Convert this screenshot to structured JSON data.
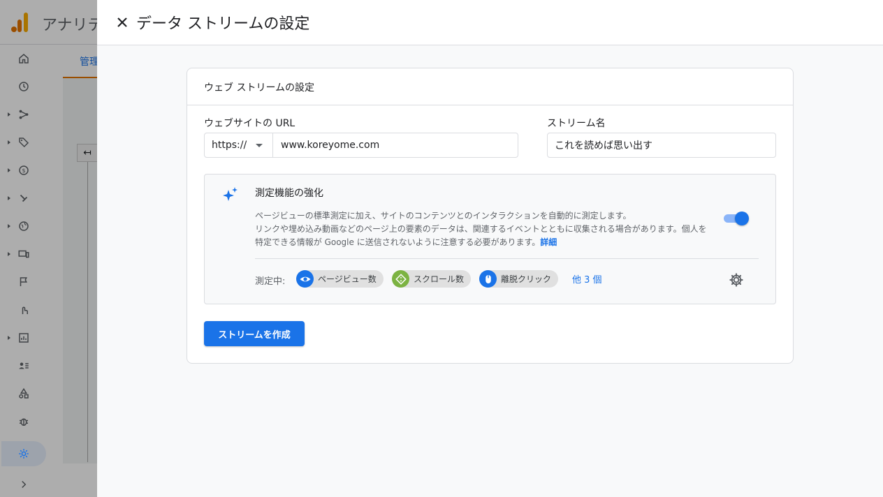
{
  "background_app": {
    "title": "アナリテ",
    "tab_label": "管理",
    "back_glyph": "↤"
  },
  "panel": {
    "title": "データ ストリームの設定"
  },
  "card": {
    "title": "ウェブ ストリームの設定",
    "url_label": "ウェブサイトの URL",
    "protocol_value": "https://",
    "url_value": "www.koreyome.com",
    "stream_name_label": "ストリーム名",
    "stream_name_value": "これを読めば思い出す"
  },
  "enhanced": {
    "title": "測定機能の強化",
    "desc_line1": "ページビューの標準測定に加え、サイトのコンテンツとのインタラクションを自動的に測定します。",
    "desc_line2": "リンクや埋め込み動画などのページ上の要素のデータは、関連するイベントとともに収集される場合があります。個人を",
    "desc_line3": "特定できる情報が Google に送信されないように注意する必要があります。",
    "details_link": "詳細",
    "toggle_on": true,
    "measuring_label": "測定中:",
    "chips": [
      {
        "label": "ページビュー数",
        "icon": "eye-icon",
        "color": "#1a73e8"
      },
      {
        "label": "スクロール数",
        "icon": "scroll-icon",
        "color": "#7cb342"
      },
      {
        "label": "離脱クリック",
        "icon": "mouse-icon",
        "color": "#1a73e8"
      }
    ],
    "more_link": "他 3 個"
  },
  "actions": {
    "create_button": "ストリームを作成"
  },
  "colors": {
    "primary": "#1a73e8",
    "toggle_track": "#8ab4f8",
    "analytics_orange": "#e37400"
  }
}
